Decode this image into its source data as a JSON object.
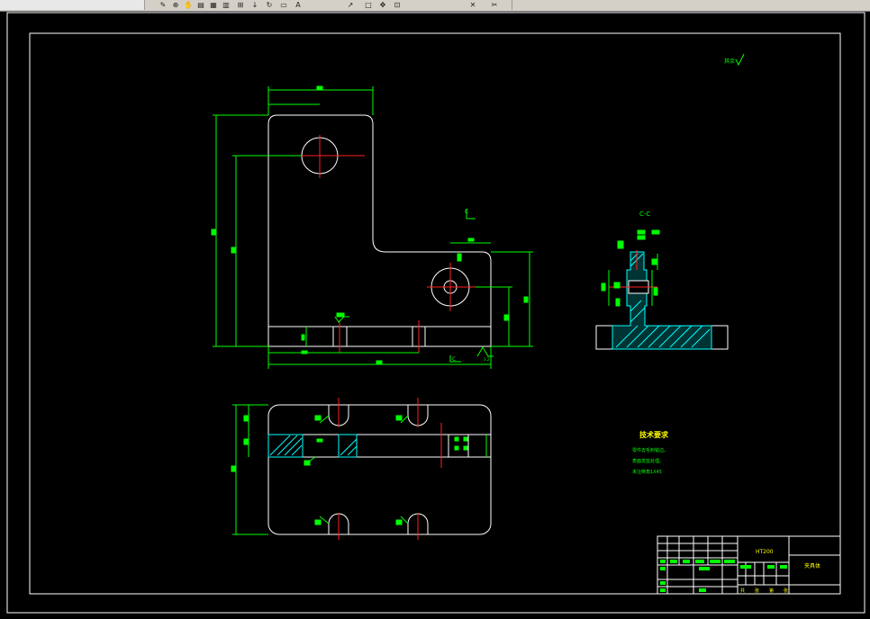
{
  "toolbar": {
    "icons": [
      "draw-icon",
      "zoom-icon",
      "layer-icon",
      "props-icon",
      "match-icon",
      "pan-icon",
      "refresh-icon",
      "block-icon",
      "text-icon",
      "arrow-icon",
      "window-icon",
      "rect-icon",
      "move-icon",
      "cross-icon",
      "snap-icon"
    ]
  },
  "drawing": {
    "section_label": "C-C",
    "section_marker_top": "C",
    "section_marker_bottom": "C",
    "surface_note": "其余",
    "roughness_value": "3.2",
    "tech_requirements": {
      "title": "技术要求",
      "lines": [
        "零件去毛刺锐边。",
        "表面发蓝处理。",
        "未注倒角1X45"
      ]
    },
    "title_block": {
      "drawing_name": "夹具体",
      "material": "HT200",
      "scale_row": [
        "共",
        "张",
        "第",
        "张"
      ]
    }
  },
  "colors": {
    "background": "#000000",
    "outline": "#ffffff",
    "dimension": "#00ff00",
    "center": "#ff0000",
    "hatch": "#00ffff",
    "text": "#ffff00"
  }
}
